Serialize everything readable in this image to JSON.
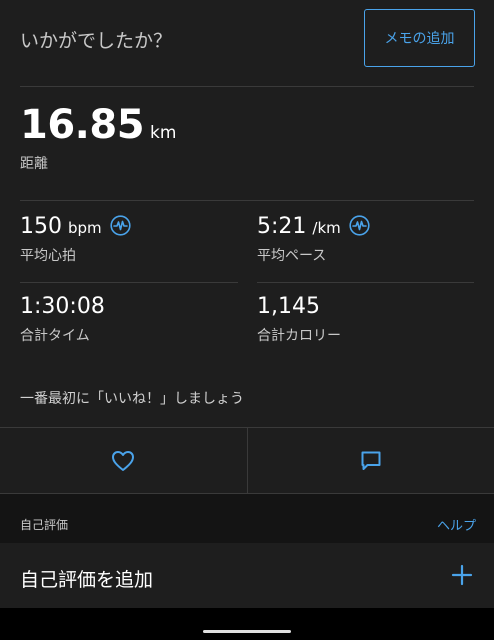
{
  "prompt": {
    "question": "いかがでしたか？",
    "memo_button": "メモの追加"
  },
  "distance": {
    "value": "16.85",
    "unit": "km",
    "label": "距離"
  },
  "stats": {
    "heart_rate": {
      "value": "150",
      "unit": "bpm",
      "label": "平均心拍",
      "icon": "heart-rate-wave-icon"
    },
    "pace": {
      "value": "5:21",
      "unit": "/km",
      "label": "平均ペース",
      "icon": "pace-wave-icon"
    },
    "time": {
      "value": "1:30:08",
      "label": "合計タイム"
    },
    "calories": {
      "value": "1,145",
      "label": "合計カロリー"
    }
  },
  "like_prompt": "一番最初に「いいね！」しましょう",
  "actions": {
    "like_icon": "heart-icon",
    "comment_icon": "comment-icon"
  },
  "rating": {
    "section_title": "自己評価",
    "help": "ヘルプ",
    "add_label": "自己評価を追加",
    "add_icon": "plus-icon"
  },
  "colors": {
    "accent": "#4aa3ea",
    "background": "#1e1e1e",
    "section_background": "#141414"
  }
}
